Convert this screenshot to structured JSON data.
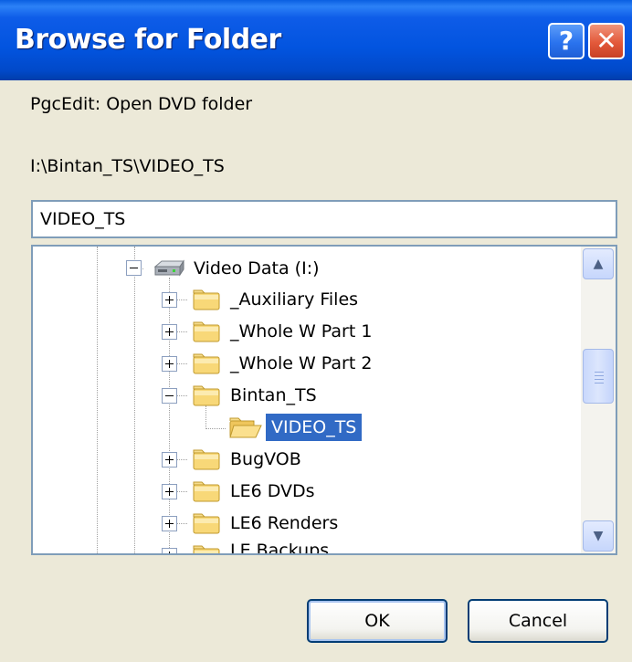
{
  "window": {
    "title": "Browse for Folder"
  },
  "titlebar": {
    "help_glyph": "?",
    "close_glyph": "✕"
  },
  "dialog": {
    "description": "PgcEdit: Open DVD folder",
    "current_path": "I:\\Bintan_TS\\VIDEO_TS",
    "folder_field_value": "VIDEO_TS"
  },
  "tree": {
    "root": {
      "label": "Video Data (I:)",
      "icon": "drive-icon",
      "expanded": true
    },
    "items": [
      {
        "label": "_Auxiliary Files",
        "icon": "folder-icon",
        "expanded": false
      },
      {
        "label": "_Whole W Part 1",
        "icon": "folder-icon",
        "expanded": false
      },
      {
        "label": "_Whole W Part 2",
        "icon": "folder-icon",
        "expanded": false
      },
      {
        "label": "Bintan_TS",
        "icon": "folder-icon",
        "expanded": true
      },
      {
        "label": "VIDEO_TS",
        "icon": "folder-open-icon",
        "selected": true
      },
      {
        "label": "BugVOB",
        "icon": "folder-icon",
        "expanded": false
      },
      {
        "label": "LE6 DVDs",
        "icon": "folder-icon",
        "expanded": false
      },
      {
        "label": "LE6 Renders",
        "icon": "folder-icon",
        "expanded": false
      },
      {
        "label": "LE Backups",
        "icon": "folder-icon",
        "expanded": false
      }
    ]
  },
  "scrollbar": {
    "up_arrow": "▲",
    "down_arrow": "▼"
  },
  "buttons": {
    "ok_label": "OK",
    "cancel_label": "Cancel"
  },
  "colors": {
    "titlebar": "#0254DF",
    "selection": "#316AC5",
    "face": "#ECE9D8",
    "border": "#7F9DB9"
  }
}
